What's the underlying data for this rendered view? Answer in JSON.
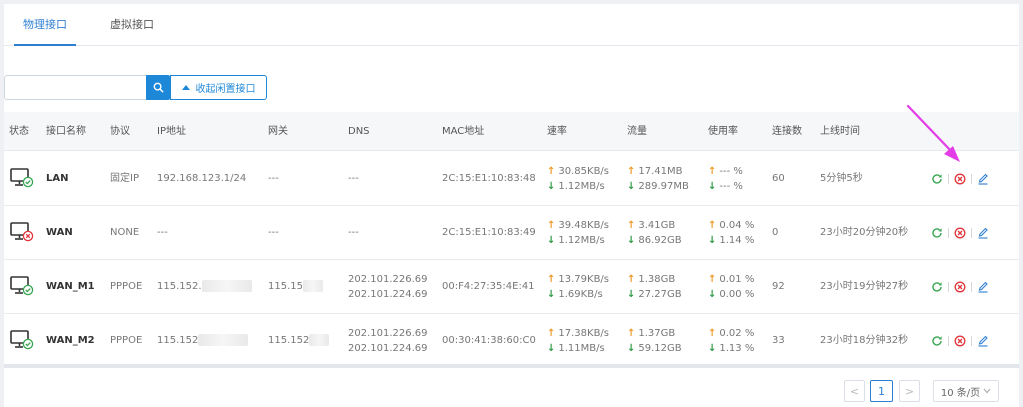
{
  "tabs": [
    {
      "label": "物理接口",
      "active": true
    },
    {
      "label": "虚拟接口",
      "active": false
    }
  ],
  "toolbar": {
    "search_placeholder": "",
    "collapse_label": "收起闲置接口"
  },
  "table": {
    "headers": [
      "状态",
      "接口名称",
      "协议",
      "IP地址",
      "网关",
      "DNS",
      "MAC地址",
      "速率",
      "流量",
      "使用率",
      "连接数",
      "上线时间"
    ],
    "rows": [
      {
        "status": "connected",
        "name": "LAN",
        "protocol": "固定IP",
        "ip": "192.168.123.1/24",
        "gateway": "---",
        "dns": [
          "---"
        ],
        "mac": "2C:15:E1:10:83:48",
        "rate_up": "30.85KB/s",
        "rate_down": "1.12MB/s",
        "traffic_up": "17.41MB",
        "traffic_down": "289.97MB",
        "usage_up": "--- %",
        "usage_down": "--- %",
        "connections": "60",
        "uptime": "5分钟5秒"
      },
      {
        "status": "disconnected",
        "name": "WAN",
        "protocol": "NONE",
        "ip": "---",
        "gateway": "---",
        "dns": [
          "---"
        ],
        "mac": "2C:15:E1:10:83:49",
        "rate_up": "39.48KB/s",
        "rate_down": "1.12MB/s",
        "traffic_up": "3.41GB",
        "traffic_down": "86.92GB",
        "usage_up": "0.04 %",
        "usage_down": "1.14 %",
        "connections": "0",
        "uptime": "23小时20分钟20秒"
      },
      {
        "status": "connected",
        "name": "WAN_M1",
        "protocol": "PPPOE",
        "ip": "115.152.",
        "gateway": "115.15",
        "dns": [
          "202.101.226.69",
          "202.101.224.69"
        ],
        "mac": "00:F4:27:35:4E:41",
        "rate_up": "13.79KB/s",
        "rate_down": "1.69KB/s",
        "traffic_up": "1.38GB",
        "traffic_down": "27.27GB",
        "usage_up": "0.01 %",
        "usage_down": "0.00 %",
        "connections": "92",
        "uptime": "23小时19分钟27秒"
      },
      {
        "status": "connected",
        "name": "WAN_M2",
        "protocol": "PPPOE",
        "ip": "115.152",
        "gateway": "115.152",
        "dns": [
          "202.101.226.69",
          "202.101.224.69"
        ],
        "mac": "00:30:41:38:60:C0",
        "rate_up": "17.38KB/s",
        "rate_down": "1.11MB/s",
        "traffic_up": "1.37GB",
        "traffic_down": "59.12GB",
        "usage_up": "0.02 %",
        "usage_down": "1.13 %",
        "connections": "33",
        "uptime": "23小时18分钟32秒"
      }
    ]
  },
  "icons": {
    "refresh": "refresh-icon",
    "disconnect": "circle-x-icon",
    "edit": "edit-pencil-icon",
    "search": "search-icon",
    "monitor": "monitor-icon"
  },
  "colors": {
    "primary": "#1e88d8",
    "up_arrow": "#ef9b2a",
    "down_arrow": "#2e9a46",
    "connected": "#3aa653",
    "disconnected": "#e0353b",
    "annotation": "#e23de6"
  },
  "pagination": {
    "prev": "<",
    "current": "1",
    "next": ">",
    "page_size": "10 条/页"
  }
}
